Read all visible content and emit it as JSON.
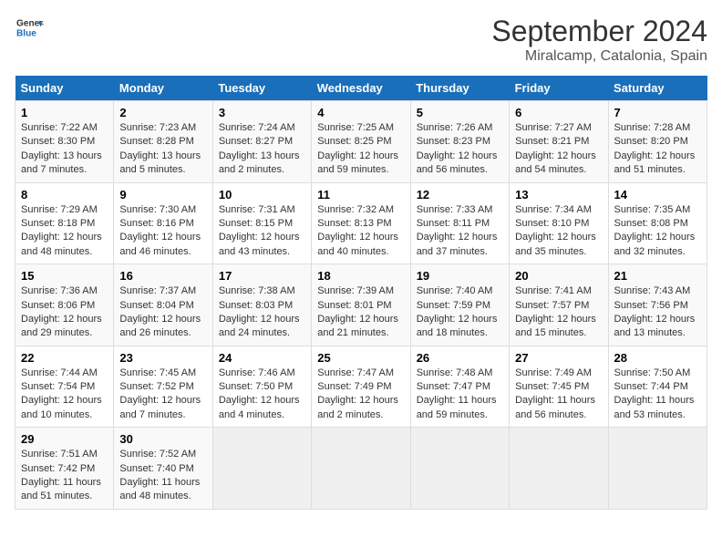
{
  "header": {
    "logo_line1": "General",
    "logo_line2": "Blue",
    "month": "September 2024",
    "location": "Miralcamp, Catalonia, Spain"
  },
  "weekdays": [
    "Sunday",
    "Monday",
    "Tuesday",
    "Wednesday",
    "Thursday",
    "Friday",
    "Saturday"
  ],
  "weeks": [
    [
      {
        "day": "1",
        "info": "Sunrise: 7:22 AM\nSunset: 8:30 PM\nDaylight: 13 hours\nand 7 minutes."
      },
      {
        "day": "2",
        "info": "Sunrise: 7:23 AM\nSunset: 8:28 PM\nDaylight: 13 hours\nand 5 minutes."
      },
      {
        "day": "3",
        "info": "Sunrise: 7:24 AM\nSunset: 8:27 PM\nDaylight: 13 hours\nand 2 minutes."
      },
      {
        "day": "4",
        "info": "Sunrise: 7:25 AM\nSunset: 8:25 PM\nDaylight: 12 hours\nand 59 minutes."
      },
      {
        "day": "5",
        "info": "Sunrise: 7:26 AM\nSunset: 8:23 PM\nDaylight: 12 hours\nand 56 minutes."
      },
      {
        "day": "6",
        "info": "Sunrise: 7:27 AM\nSunset: 8:21 PM\nDaylight: 12 hours\nand 54 minutes."
      },
      {
        "day": "7",
        "info": "Sunrise: 7:28 AM\nSunset: 8:20 PM\nDaylight: 12 hours\nand 51 minutes."
      }
    ],
    [
      {
        "day": "8",
        "info": "Sunrise: 7:29 AM\nSunset: 8:18 PM\nDaylight: 12 hours\nand 48 minutes."
      },
      {
        "day": "9",
        "info": "Sunrise: 7:30 AM\nSunset: 8:16 PM\nDaylight: 12 hours\nand 46 minutes."
      },
      {
        "day": "10",
        "info": "Sunrise: 7:31 AM\nSunset: 8:15 PM\nDaylight: 12 hours\nand 43 minutes."
      },
      {
        "day": "11",
        "info": "Sunrise: 7:32 AM\nSunset: 8:13 PM\nDaylight: 12 hours\nand 40 minutes."
      },
      {
        "day": "12",
        "info": "Sunrise: 7:33 AM\nSunset: 8:11 PM\nDaylight: 12 hours\nand 37 minutes."
      },
      {
        "day": "13",
        "info": "Sunrise: 7:34 AM\nSunset: 8:10 PM\nDaylight: 12 hours\nand 35 minutes."
      },
      {
        "day": "14",
        "info": "Sunrise: 7:35 AM\nSunset: 8:08 PM\nDaylight: 12 hours\nand 32 minutes."
      }
    ],
    [
      {
        "day": "15",
        "info": "Sunrise: 7:36 AM\nSunset: 8:06 PM\nDaylight: 12 hours\nand 29 minutes."
      },
      {
        "day": "16",
        "info": "Sunrise: 7:37 AM\nSunset: 8:04 PM\nDaylight: 12 hours\nand 26 minutes."
      },
      {
        "day": "17",
        "info": "Sunrise: 7:38 AM\nSunset: 8:03 PM\nDaylight: 12 hours\nand 24 minutes."
      },
      {
        "day": "18",
        "info": "Sunrise: 7:39 AM\nSunset: 8:01 PM\nDaylight: 12 hours\nand 21 minutes."
      },
      {
        "day": "19",
        "info": "Sunrise: 7:40 AM\nSunset: 7:59 PM\nDaylight: 12 hours\nand 18 minutes."
      },
      {
        "day": "20",
        "info": "Sunrise: 7:41 AM\nSunset: 7:57 PM\nDaylight: 12 hours\nand 15 minutes."
      },
      {
        "day": "21",
        "info": "Sunrise: 7:43 AM\nSunset: 7:56 PM\nDaylight: 12 hours\nand 13 minutes."
      }
    ],
    [
      {
        "day": "22",
        "info": "Sunrise: 7:44 AM\nSunset: 7:54 PM\nDaylight: 12 hours\nand 10 minutes."
      },
      {
        "day": "23",
        "info": "Sunrise: 7:45 AM\nSunset: 7:52 PM\nDaylight: 12 hours\nand 7 minutes."
      },
      {
        "day": "24",
        "info": "Sunrise: 7:46 AM\nSunset: 7:50 PM\nDaylight: 12 hours\nand 4 minutes."
      },
      {
        "day": "25",
        "info": "Sunrise: 7:47 AM\nSunset: 7:49 PM\nDaylight: 12 hours\nand 2 minutes."
      },
      {
        "day": "26",
        "info": "Sunrise: 7:48 AM\nSunset: 7:47 PM\nDaylight: 11 hours\nand 59 minutes."
      },
      {
        "day": "27",
        "info": "Sunrise: 7:49 AM\nSunset: 7:45 PM\nDaylight: 11 hours\nand 56 minutes."
      },
      {
        "day": "28",
        "info": "Sunrise: 7:50 AM\nSunset: 7:44 PM\nDaylight: 11 hours\nand 53 minutes."
      }
    ],
    [
      {
        "day": "29",
        "info": "Sunrise: 7:51 AM\nSunset: 7:42 PM\nDaylight: 11 hours\nand 51 minutes."
      },
      {
        "day": "30",
        "info": "Sunrise: 7:52 AM\nSunset: 7:40 PM\nDaylight: 11 hours\nand 48 minutes."
      },
      null,
      null,
      null,
      null,
      null
    ]
  ]
}
